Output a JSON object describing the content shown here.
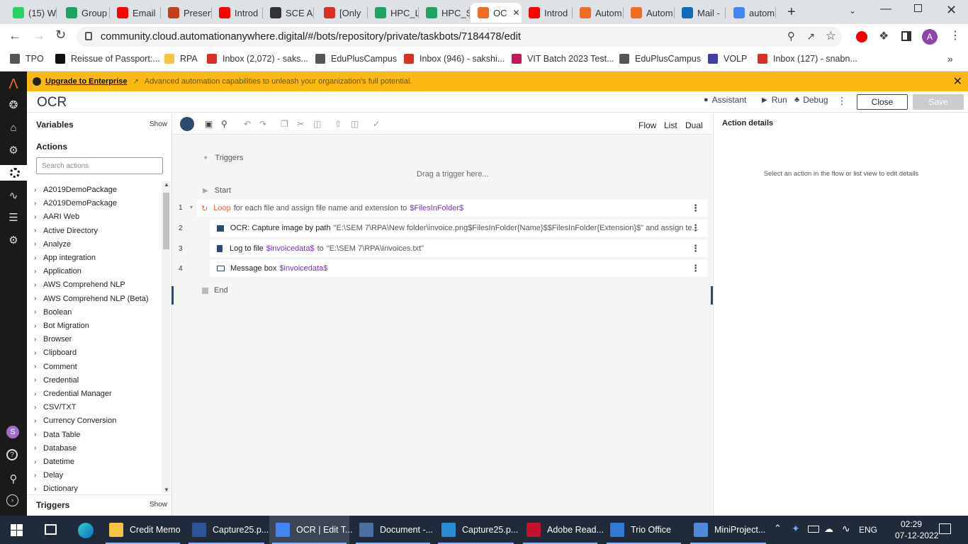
{
  "browser": {
    "tabs": [
      {
        "label": "(15) W",
        "icon": "whatsapp-icon",
        "color": "#25d366"
      },
      {
        "label": "Group",
        "icon": "google-drive-icon",
        "color": "#1ea362"
      },
      {
        "label": "Email",
        "icon": "youtube-icon",
        "color": "#ff0000"
      },
      {
        "label": "Presen",
        "icon": "powerpoint-icon",
        "color": "#c43e1c"
      },
      {
        "label": "Introd",
        "icon": "youtube-icon",
        "color": "#ff0000"
      },
      {
        "label": "SCE A",
        "icon": "classroom-icon",
        "color": "#333333"
      },
      {
        "label": "[Only",
        "icon": "gmail-icon",
        "color": "#d93025"
      },
      {
        "label": "HPC_L",
        "icon": "google-drive-icon",
        "color": "#1ea362"
      },
      {
        "label": "HPC_S",
        "icon": "google-drive-icon",
        "color": "#1ea362"
      },
      {
        "label": "OC",
        "icon": "automation-anywhere-icon",
        "color": "#f26b21"
      },
      {
        "label": "Introd",
        "icon": "youtube-icon",
        "color": "#ff0000"
      },
      {
        "label": "Autom",
        "icon": "automation-anywhere-icon",
        "color": "#f26b21"
      },
      {
        "label": "Autom",
        "icon": "automation-anywhere-icon",
        "color": "#f26b21"
      },
      {
        "label": "Mail -",
        "icon": "outlook-icon",
        "color": "#0f6cbd"
      },
      {
        "label": "autom",
        "icon": "google-icon",
        "color": "#4285f4"
      }
    ],
    "url": "community.cloud.automationanywhere.digital/#/bots/repository/private/taskbots/7184478/edit",
    "profile_initial": "A",
    "bookmarks": [
      {
        "label": "TPO",
        "color": "#555555"
      },
      {
        "label": "Reissue of Passport:...",
        "color": "#111111"
      },
      {
        "label": "RPA",
        "color": "#f6c343"
      },
      {
        "label": "Inbox (2,072) - saks...",
        "color": "#d93025"
      },
      {
        "label": "EduPlusCampus",
        "color": "#555555"
      },
      {
        "label": "Inbox (946) - sakshi...",
        "color": "#d93025"
      },
      {
        "label": "VIT Batch 2023 Test...",
        "color": "#c2185b"
      },
      {
        "label": "EduPlusCampus",
        "color": "#555555"
      },
      {
        "label": "VOLP",
        "color": "#3f3fa5"
      },
      {
        "label": "Inbox (127) - snabn...",
        "color": "#d93025"
      }
    ]
  },
  "banner": {
    "link": "Upgrade to Enterprise",
    "text": "Advanced automation capabilities to unleash your organization's full potential."
  },
  "header": {
    "title": "OCR",
    "assistant": "Assistant",
    "run": "Run",
    "debug": "Debug",
    "close": "Close",
    "save": "Save"
  },
  "sidebar": {
    "variables": "Variables",
    "variables_show": "Show",
    "actions": "Actions",
    "search_placeholder": "Search actions",
    "items": [
      "A2019DemoPackage",
      "A2019DemoPackage",
      "AARI Web",
      "Active Directory",
      "Analyze",
      "App integration",
      "Application",
      "AWS Comprehend NLP",
      "AWS Comprehend NLP (Beta)",
      "Boolean",
      "Bot Migration",
      "Browser",
      "Clipboard",
      "Comment",
      "Credential",
      "Credential Manager",
      "CSV/TXT",
      "Currency Conversion",
      "Data Table",
      "Database",
      "Datetime",
      "Delay",
      "Dictionary"
    ],
    "triggers": "Triggers",
    "triggers_show": "Show",
    "user_initial": "S"
  },
  "editor": {
    "views": [
      "Flow",
      "List",
      "Dual"
    ],
    "triggers": "Triggers",
    "drag_hint": "Drag a trigger here...",
    "start": "Start",
    "end": "End",
    "lines": [
      {
        "num": "1",
        "keyword": "Loop",
        "text": "for each file and assign file name and extension to",
        "var": "$FilesInFolder$"
      },
      {
        "num": "2",
        "keyword": "OCR: Capture image by path",
        "text": "\"E:\\SEM 7\\RPA\\New folder\\invoice.png$FilesInFolder{Name}$$FilesInFolder{Extension}$\" and assign te..."
      },
      {
        "num": "3",
        "keyword": "Log to file",
        "var": "$invoicedata$",
        "text": "to",
        "text2": "\"E:\\SEM 7\\RPA\\Invoices.txt\""
      },
      {
        "num": "4",
        "keyword": "Message box",
        "var": "$invoicedata$"
      }
    ]
  },
  "details": {
    "title": "Action details",
    "hint": "Select an action in the flow or list view to edit details"
  },
  "taskbar": {
    "apps": [
      {
        "label": "Credit Memo",
        "color": "#f6c343"
      },
      {
        "label": "Capture25.p...",
        "color": "#2b579a"
      },
      {
        "label": "OCR | Edit T...",
        "color": "#4285f4"
      },
      {
        "label": "Document -...",
        "color": "#4a6fa5"
      },
      {
        "label": "Capture25.p...",
        "color": "#2a8dd4"
      },
      {
        "label": "Adobe Read...",
        "color": "#c8102e"
      },
      {
        "label": "Trio Office",
        "color": "#2f7bd6"
      },
      {
        "label": "MiniProject...",
        "color": "#4b8bd8"
      }
    ],
    "lang": "ENG",
    "time": "02:29",
    "date": "07-12-2022"
  }
}
